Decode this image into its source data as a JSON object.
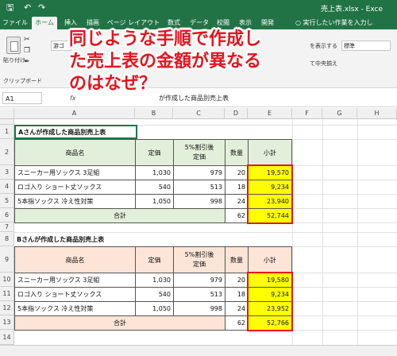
{
  "titlebar": {
    "filename": "売上表.xlsx  -  Exce",
    "save_icon": "save-icon",
    "undo_icon": "undo-icon",
    "redo_icon": "redo-icon"
  },
  "tabs": [
    "ファイル",
    "ホーム",
    "挿入",
    "描画",
    "ページ レイアウト",
    "数式",
    "データ",
    "校閲",
    "表示",
    "開発"
  ],
  "tell_me": "実行したい作業を入力し",
  "ribbon": {
    "paste_label": "貼り付け",
    "clipboard_label": "クリップボード",
    "font_name": "游ゴ",
    "wrap_text": "を表示する",
    "merge_center": "て中央揃え",
    "number_format": "標準"
  },
  "formula_bar": {
    "cell_ref": "A1",
    "fx_label": "fx",
    "content": "が作成した商品別売上表"
  },
  "callout": {
    "line1": "同じような手順で作成し",
    "line2": "た売上表の金額が異なる",
    "line3": "のはなぜ？"
  },
  "columns": [
    "A",
    "B",
    "C",
    "D",
    "E",
    "F",
    "G",
    "H"
  ],
  "rows": [
    "1",
    "2",
    "3",
    "4",
    "5",
    "6",
    "7",
    "8",
    "9",
    "10",
    "11",
    "12",
    "13",
    "14"
  ],
  "tableA": {
    "title": "Aさんが作成した商品別売上表",
    "headers": {
      "name": "商品名",
      "price": "定価",
      "discount": "5%割引後\n定価",
      "qty": "数量",
      "subtotal": "小計"
    },
    "items": [
      {
        "name": "スニーカー用ソックス 3足組",
        "price": "1,030",
        "discount": "979",
        "qty": "20",
        "subtotal": "19,570"
      },
      {
        "name": "ロゴ入り ショート丈ソックス",
        "price": "540",
        "discount": "513",
        "qty": "18",
        "subtotal": "9,234"
      },
      {
        "name": "5本指ソックス 冷え性対策",
        "price": "1,050",
        "discount": "998",
        "qty": "24",
        "subtotal": "23,940"
      }
    ],
    "total_label": "合計",
    "total_qty": "62",
    "total": "52,744"
  },
  "tableB": {
    "title": "Bさんが作成した商品別売上表",
    "headers": {
      "name": "商品名",
      "price": "定価",
      "discount": "5%割引後\n定価",
      "qty": "数量",
      "subtotal": "小計"
    },
    "items": [
      {
        "name": "スニーカー用ソックス 3足組",
        "price": "1,030",
        "discount": "979",
        "qty": "20",
        "subtotal": "19,580"
      },
      {
        "name": "ロゴ入り ショート丈ソックス",
        "price": "540",
        "discount": "513",
        "qty": "18",
        "subtotal": "9,234"
      },
      {
        "name": "5本指ソックス 冷え性対策",
        "price": "1,050",
        "discount": "998",
        "qty": "24",
        "subtotal": "23,952"
      }
    ],
    "total_label": "合計",
    "total_qty": "62",
    "total": "52,766"
  },
  "colors": {
    "excel_green": "#217346",
    "header_green": "#e2efda",
    "header_peach": "#fce4d6",
    "highlight": "#ffff00",
    "callout_red": "#e6131d"
  }
}
